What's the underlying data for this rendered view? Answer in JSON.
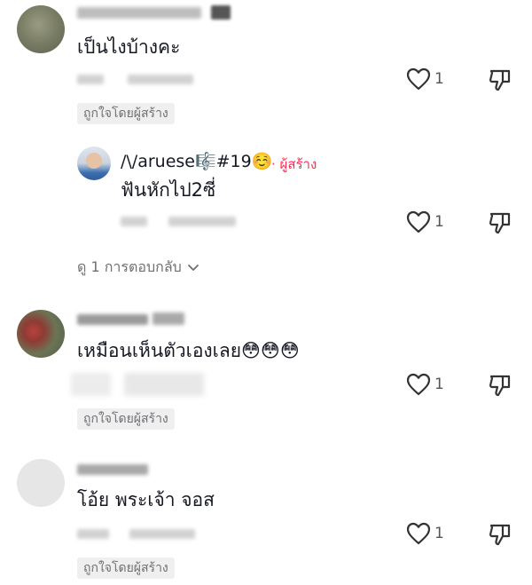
{
  "colors": {
    "accent": "#fe2c55",
    "text": "#161823",
    "muted": "#6f6f74",
    "badge_bg": "#efefef"
  },
  "comments": [
    {
      "text": "เป็นไงบ้างคะ",
      "likes": "1",
      "liked_by_creator": "ถูกใจโดยผู้สร้าง",
      "reply": {
        "author": "/\\/aruese🎼#19☺️",
        "creator_tag": "· ผู้สร้าง",
        "text": "ฟันหักไป2ซี่",
        "likes": "1"
      },
      "view_replies": "ดู 1 การตอบกลับ"
    },
    {
      "text": "เหมือนเห็นตัวเองเลย😳😳😳",
      "likes": "1",
      "liked_by_creator": "ถูกใจโดยผู้สร้าง"
    },
    {
      "text": "โอ้ย พระเจ้า จอส",
      "likes": "1",
      "liked_by_creator": "ถูกใจโดยผู้สร้าง"
    }
  ],
  "icons": {
    "like": "heart-outline-icon",
    "dislike": "thumbs-down-icon",
    "chevron": "chevron-down-icon"
  }
}
